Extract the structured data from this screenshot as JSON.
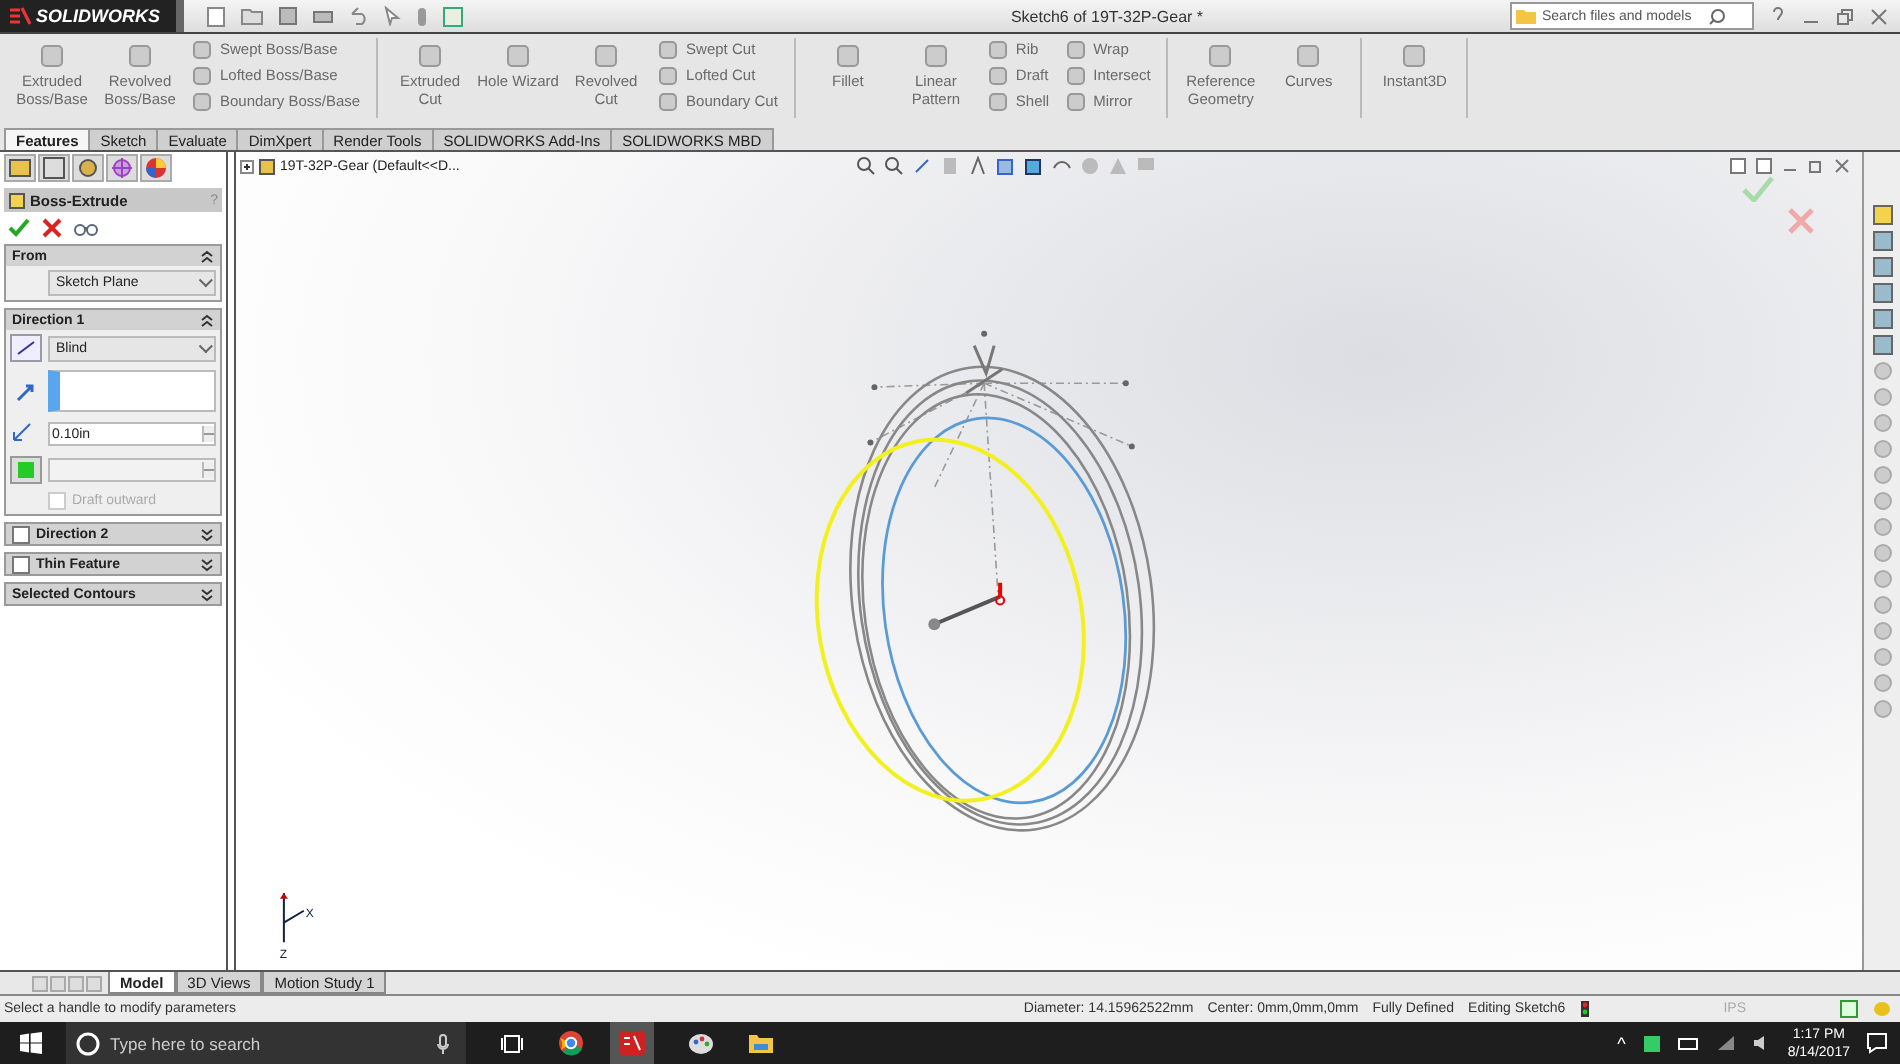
{
  "app": {
    "logo": "SOLIDWORKS",
    "title": "Sketch6 of 19T-32P-Gear *",
    "search_placeholder": "Search files and models"
  },
  "ribbon": [
    {
      "columns": [
        {
          "kind": "big",
          "label": "Extruded Boss/Base"
        },
        {
          "kind": "big",
          "label": "Revolved Boss/Base"
        },
        {
          "kind": "stack",
          "items": [
            "Swept Boss/Base",
            "Lofted Boss/Base",
            "Boundary Boss/Base"
          ]
        }
      ]
    },
    {
      "columns": [
        {
          "kind": "big",
          "label": "Extruded Cut"
        },
        {
          "kind": "big",
          "label": "Hole Wizard"
        },
        {
          "kind": "big",
          "label": "Revolved Cut"
        },
        {
          "kind": "stack",
          "items": [
            "Swept Cut",
            "Lofted Cut",
            "Boundary Cut"
          ]
        }
      ]
    },
    {
      "columns": [
        {
          "kind": "big",
          "label": "Fillet"
        },
        {
          "kind": "big",
          "label": "Linear Pattern"
        },
        {
          "kind": "stack",
          "items": [
            "Rib",
            "Draft",
            "Shell"
          ]
        },
        {
          "kind": "stack",
          "items": [
            "Wrap",
            "Intersect",
            "Mirror"
          ]
        }
      ]
    },
    {
      "columns": [
        {
          "kind": "big",
          "label": "Reference Geometry"
        },
        {
          "kind": "big",
          "label": "Curves"
        }
      ]
    },
    {
      "columns": [
        {
          "kind": "big",
          "label": "Instant3D"
        }
      ]
    }
  ],
  "command_tabs": [
    {
      "label": "Features",
      "selected": true
    },
    {
      "label": "Sketch",
      "selected": false
    },
    {
      "label": "Evaluate",
      "selected": false
    },
    {
      "label": "DimXpert",
      "selected": false
    },
    {
      "label": "Render Tools",
      "selected": false
    },
    {
      "label": "SOLIDWORKS Add-Ins",
      "selected": false
    },
    {
      "label": "SOLIDWORKS MBD",
      "selected": false
    }
  ],
  "property_manager": {
    "title": "Boss-Extrude",
    "help": "?",
    "sections": [
      {
        "title": "From",
        "expanded": true,
        "fields": [
          {
            "kind": "select",
            "value": "Sketch Plane"
          }
        ]
      },
      {
        "title": "Direction 1",
        "expanded": true,
        "fields": [
          {
            "kind": "select-icon",
            "value": "Blind"
          },
          {
            "kind": "selection"
          },
          {
            "kind": "spin",
            "value": "0.10in"
          },
          {
            "kind": "spin-blank"
          },
          {
            "kind": "checkbox",
            "label": "Draft outward",
            "checked": false,
            "disabled": true
          }
        ]
      },
      {
        "title": "Direction 2",
        "expanded": false,
        "checked": false
      },
      {
        "title": "Thin Feature",
        "expanded": false,
        "checked": false
      },
      {
        "title": "Selected Contours",
        "expanded": false
      }
    ]
  },
  "feature_tree": {
    "root": "19T-32P-Gear  (Default<<D..."
  },
  "triad": {
    "x": "X",
    "z": "Z"
  },
  "bottom_tabs": [
    {
      "label": "Model",
      "selected": true
    },
    {
      "label": "3D Views",
      "selected": false
    },
    {
      "label": "Motion Study 1",
      "selected": false
    }
  ],
  "status_bar": {
    "message": "Select a handle to modify parameters",
    "items": [
      "Diameter: 14.15962522mm",
      "Center: 0mm,0mm,0mm",
      "Fully Defined",
      "Editing Sketch6"
    ],
    "units": "IPS"
  },
  "taskbar": {
    "search_placeholder": "Type here to search",
    "tray_caret": "^",
    "time": "1:17 PM",
    "date": "8/14/2017"
  }
}
